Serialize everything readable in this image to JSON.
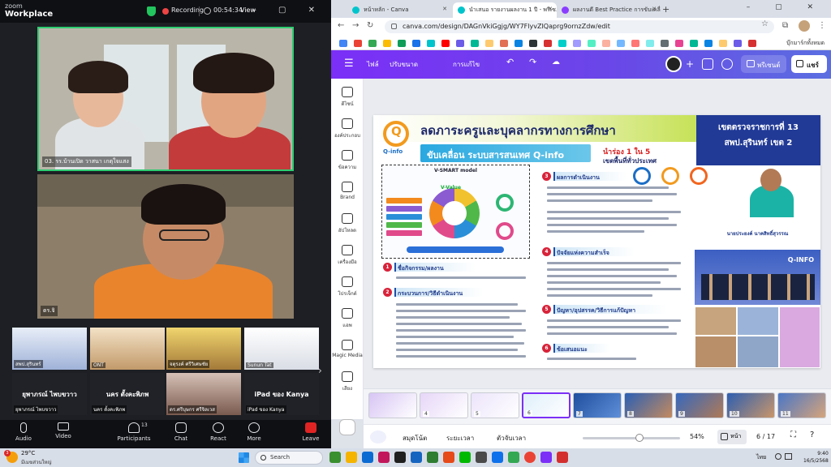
{
  "zoom": {
    "brand_top": "zoom",
    "brand_bottom": "Workplace",
    "recording_label": "Recording",
    "elapsed": "00:54:34",
    "view_label": "View",
    "tile1_name": "03. รร.บ้านเปิด วาสนา เกตุใจแสง",
    "tile2_name": "ดร.จิ",
    "gallery": [
      {
        "label": "สพป.สุรินทร์",
        "kind": "video"
      },
      {
        "label": "ONT",
        "kind": "video"
      },
      {
        "label": "จตุรงค์ ศรีวิเศษชัย",
        "kind": "video"
      },
      {
        "label": "Sunun Tat",
        "kind": "video"
      },
      {
        "name": "ยุพาภรณ์ ไพบขวาว",
        "label": "ยุพาภรณ์ ไพบขวาว",
        "kind": "name"
      },
      {
        "name": "นคร ตั้งคะพิภพ",
        "label": "นคร ตั้งคะพิภพ",
        "kind": "name"
      },
      {
        "label": "ดร.ศรีบุษกร ศรีจิลเวส",
        "kind": "video"
      },
      {
        "name": "iPad ของ Kanya",
        "label": "iPad ของ Kanya",
        "kind": "name"
      }
    ],
    "toolbar": {
      "audio": "Audio",
      "video": "Video",
      "participants": "Participants",
      "participants_count": "13",
      "chat": "Chat",
      "react": "React",
      "more": "More",
      "leave": "Leave"
    }
  },
  "browser": {
    "tabs": [
      {
        "title": "หน้าหลัก - Canva",
        "color": "#00c4cc",
        "active": false
      },
      {
        "title": "นำเสนอ รายงานผลงาน 1 ปี - พรีเซ...",
        "color": "#00c4cc",
        "active": true
      },
      {
        "title": "ผลงานดี Best Practice การขับเคลื่อ...",
        "color": "#8b3dff",
        "active": false
      }
    ],
    "url": "canva.com/design/DAGnVkiGgjg/WY7FlyvZIQaprg9ornzZdw/edit",
    "bookmark_folder": "บุ๊กมาร์กทั้งหมด"
  },
  "canva": {
    "file_label": "ไฟล์",
    "resize_label": "ปรับขนาด",
    "edit_label": "การแก้ไข",
    "present_label": "พรีเซนต์",
    "share_label": "แชร์",
    "side_items": [
      "ดีไซน์",
      "องค์ประกอบ",
      "ข้อความ",
      "Brand",
      "อัปโหลด",
      "เครื่องมือ",
      "โปรเจ็กต์",
      "แอพ",
      "Magic Media",
      "เสียง"
    ],
    "notes_label": "สมุดโน้ต",
    "timer_label": "ระยะเวลา",
    "record_label": "ตัวจับเวลา",
    "zoom_percent": "54%",
    "zoom_value": 54,
    "page_label": "หน้า",
    "page_counter": "6 / 17",
    "thumbnails": [
      "",
      "4",
      "5",
      "6",
      "7",
      "8",
      "9",
      "10",
      "11"
    ],
    "selected_thumbnail": 3
  },
  "slide": {
    "title": "ลดภาระครูและบุคลากรทางการศึกษา",
    "logo_text": "Q-info",
    "subtitle": "ขับเคลื่อน ระบบสารสนเทศ Q-info",
    "rank_line1": "นำร่อง 1 ใน 5",
    "rank_line2": "เขตพื้นที่ทั่วประเทศ",
    "badge_line1": "เขตตรวจราชการที่ 13",
    "badge_line2": "สพป.สุรินทร์ เขต 2",
    "model_title": "V-SMART model",
    "model_center": "V-Value",
    "sections_left": [
      {
        "num": "1",
        "title": "ชื่อกิจกรรม/ผลงาน"
      },
      {
        "num": "2",
        "title": "กระบวนการ/วิธีดำเนินงาน"
      }
    ],
    "sections_right": [
      {
        "num": "3",
        "title": "ผลการดำเนินงาน"
      },
      {
        "num": "4",
        "title": "ปัจจัยแห่งความสำเร็จ"
      },
      {
        "num": "5",
        "title": "ปัญหา/อุปสรรค/วิธีการแก้ปัญหา"
      },
      {
        "num": "6",
        "title": "ข้อเสนอแนะ"
      }
    ],
    "person_name": "นายประยงค์ นาคสิทธิ์สุวรรณ",
    "photo_banner": "Q-INFO"
  },
  "taskbar": {
    "temp": "29°C",
    "weather": "มีเมฆส่วนใหญ่",
    "notif_count": "3",
    "search_label": "Search",
    "lang": "ไทย",
    "time": "9:40",
    "date": "16/5/2568"
  }
}
